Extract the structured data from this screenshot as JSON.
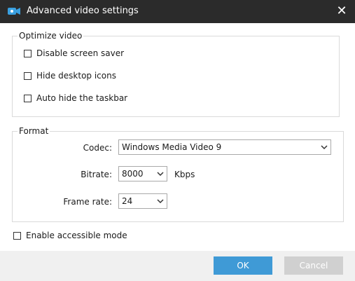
{
  "window": {
    "title": "Advanced video settings",
    "close_glyph": "✕"
  },
  "optimize_group": {
    "label": "Optimize video",
    "options": [
      {
        "label": "Disable screen saver",
        "checked": false
      },
      {
        "label": "Hide desktop icons",
        "checked": false
      },
      {
        "label": "Auto hide the taskbar",
        "checked": false
      }
    ]
  },
  "format_group": {
    "label": "Format",
    "codec": {
      "label": "Codec:",
      "value": "Windows Media Video 9"
    },
    "bitrate": {
      "label": "Bitrate:",
      "value": "8000",
      "unit": "Kbps"
    },
    "frame_rate": {
      "label": "Frame rate:",
      "value": "24"
    }
  },
  "accessible_mode": {
    "label": "Enable accessible mode",
    "checked": false
  },
  "buttons": {
    "ok": "OK",
    "cancel": "Cancel"
  },
  "colors": {
    "titlebar": "#2b2b2b",
    "ok_button": "#3f9ad6",
    "cancel_button": "#d0d0d0",
    "footer": "#f0f0f0"
  },
  "icons": {
    "app": "video-camera-icon",
    "close": "close-icon",
    "dropdown": "chevron-down-icon"
  }
}
